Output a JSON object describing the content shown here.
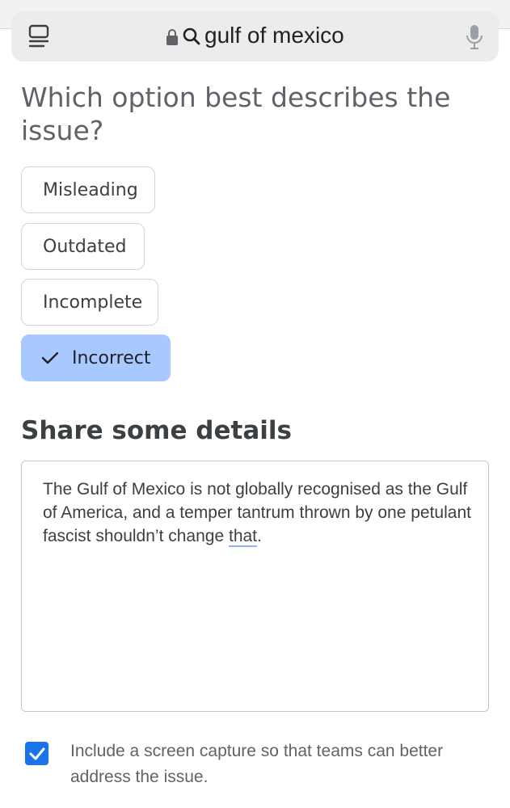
{
  "browser": {
    "query": "gulf of mexico"
  },
  "question": {
    "title": "Which option best describes the issue?"
  },
  "options": [
    {
      "label": "Misleading",
      "selected": false
    },
    {
      "label": "Outdated",
      "selected": false
    },
    {
      "label": "Incomplete",
      "selected": false
    },
    {
      "label": "Incorrect",
      "selected": true
    }
  ],
  "details": {
    "heading": "Share some details",
    "text_before": "The Gulf of Mexico is not globally recognised as the Gulf of America, and a temper tantrum thrown by one petulant fascist shouldn’t change ",
    "text_underlined": "that",
    "text_after": "."
  },
  "screen_capture": {
    "checked": true,
    "label": "Include a screen capture so that teams can better address the issue."
  },
  "colors": {
    "selected_option": "#a8c9ff",
    "checkbox": "#1a73e8",
    "address_bar": "#ececec"
  }
}
